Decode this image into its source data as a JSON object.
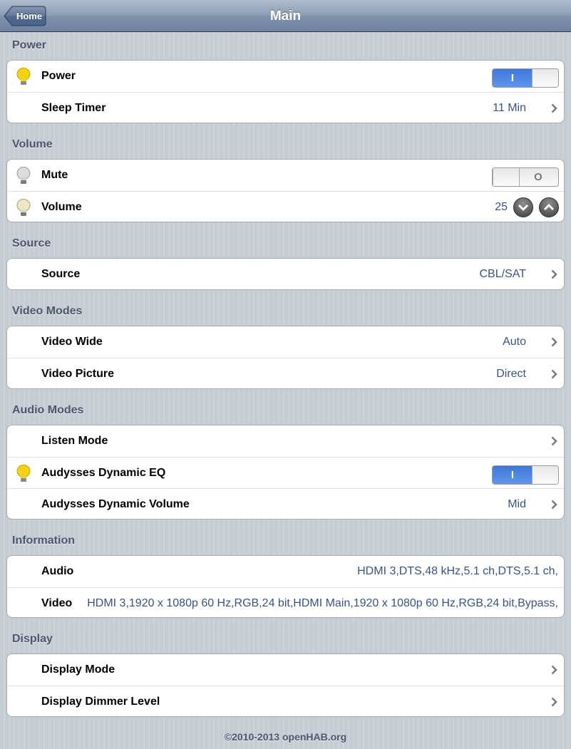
{
  "nav": {
    "back_label": "Home",
    "title": "Main"
  },
  "sections": {
    "power": {
      "title": "Power",
      "power": {
        "label": "Power",
        "switch_on": "I"
      },
      "sleep_timer": {
        "label": "Sleep Timer",
        "value": "11 Min"
      }
    },
    "volume": {
      "title": "Volume",
      "mute": {
        "label": "Mute",
        "switch_off": "O"
      },
      "volume": {
        "label": "Volume",
        "value": "25"
      }
    },
    "source": {
      "title": "Source",
      "source": {
        "label": "Source",
        "value": "CBL/SAT"
      }
    },
    "video_modes": {
      "title": "Video Modes",
      "video_wide": {
        "label": "Video Wide",
        "value": "Auto"
      },
      "video_picture": {
        "label": "Video Picture",
        "value": "Direct"
      }
    },
    "audio_modes": {
      "title": "Audio Modes",
      "listen_mode": {
        "label": "Listen Mode"
      },
      "dynamic_eq": {
        "label": "Audysses Dynamic EQ",
        "switch_on": "I"
      },
      "dynamic_volume": {
        "label": "Audysses Dynamic Volume",
        "value": "Mid"
      }
    },
    "information": {
      "title": "Information",
      "audio": {
        "label": "Audio",
        "value": "HDMI 3,DTS,48 kHz,5.1 ch,DTS,5.1 ch,"
      },
      "video": {
        "label": "Video",
        "value": "HDMI 3,1920 x 1080p 60 Hz,RGB,24 bit,HDMI Main,1920 x 1080p 60 Hz,RGB,24 bit,Bypass,"
      }
    },
    "display": {
      "title": "Display",
      "display_mode": {
        "label": "Display Mode"
      },
      "dimmer_level": {
        "label": "Display Dimmer Level"
      }
    }
  },
  "footer": "©2010-2013 openHAB.org",
  "colors": {
    "value_text": "#385487",
    "switch_on": "#4a85e0",
    "section_title": "#4c566c",
    "bulb_on": "#f5d312",
    "bulb_off": "#d8d8d8"
  },
  "icons": {
    "bulb_on": "light-bulb-on-icon",
    "bulb_off": "light-bulb-off-icon",
    "chevron": "chevron-right-icon",
    "volume_down": "chevron-down-circle-icon",
    "volume_up": "chevron-up-circle-icon"
  }
}
